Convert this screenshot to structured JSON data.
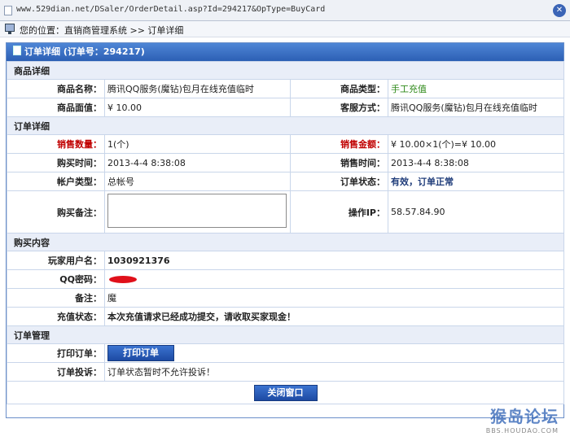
{
  "browser": {
    "url": "www.529dian.net/DSaler/OrderDetail.asp?Id=294217&OpType=BuyCard",
    "close_symbol": "✕"
  },
  "breadcrumb": {
    "text": "您的位置：直销商管理系统 >> 订单详细"
  },
  "panel": {
    "title": "订单详细 (订单号：294217)"
  },
  "sections": {
    "product": "商品详细",
    "order": "订单详细",
    "purchase": "购买内容",
    "manage": "订单管理"
  },
  "product": {
    "name_label": "商品名称：",
    "name_value": "腾讯QQ服务(魔钻)包月在线充值临时",
    "type_label": "商品类型：",
    "type_value": "手工充值",
    "face_label": "商品面值：",
    "face_value": "¥ 10.00",
    "service_label": "客服方式：",
    "service_value": "腾讯QQ服务(魔钻)包月在线充值临时"
  },
  "order": {
    "qty_label": "销售数量：",
    "qty_value": "1(个)",
    "amount_label": "销售金额：",
    "amount_value": "¥ 10.00×1(个)=¥ 10.00",
    "buy_time_label": "购买时间：",
    "buy_time_value": "2013-4-4 8:38:08",
    "sale_time_label": "销售时间：",
    "sale_time_value": "2013-4-4 8:38:08",
    "account_type_label": "帐户类型：",
    "account_type_value": "总帐号",
    "status_label": "订单状态：",
    "status_value": "有效，订单正常",
    "remark_label": "购买备注：",
    "remark_value": "",
    "ip_label": "操作IP：",
    "ip_value": "58.57.84.90"
  },
  "purchase": {
    "user_label": "玩家用户名：",
    "user_value": "1030921376",
    "pwd_label": "QQ密码：",
    "note_label": "备注：",
    "note_value": "魔",
    "charge_label": "充值状态：",
    "charge_value": "本次充值请求已经成功提交，请收取买家现金！"
  },
  "manage": {
    "print_label": "打印订单：",
    "print_button": "打印订单",
    "complaint_label": "订单投诉：",
    "complaint_value": "订单状态暂时不允许投诉！",
    "close_button": "关闭窗口"
  },
  "watermark": {
    "main": "猴岛论坛",
    "sub": "BBS.HOUDAO.COM"
  },
  "colors": {
    "header_blue": "#2c5fb4",
    "label_red": "#c00000",
    "type_green": "#2f8a1a"
  }
}
